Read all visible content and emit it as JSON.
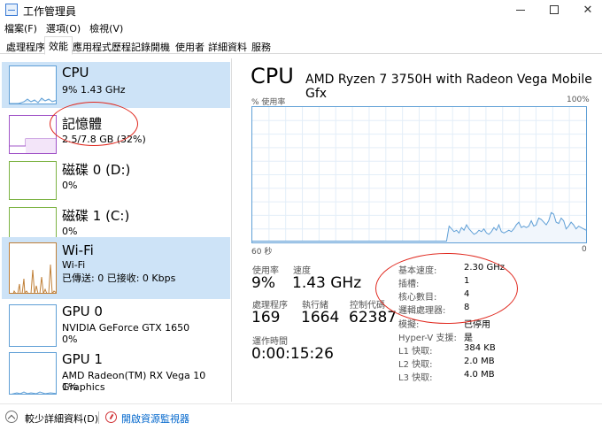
{
  "window": {
    "title": "工作管理員"
  },
  "menu": [
    "檔案(F)",
    "選項(O)",
    "檢視(V)"
  ],
  "tabs": [
    "處理程序",
    "效能",
    "應用程式歷程記錄",
    "開機",
    "使用者",
    "詳細資料",
    "服務"
  ],
  "active_tab": "效能",
  "sidebar": {
    "items": [
      {
        "title": "CPU",
        "sub1": "9% 1.43 GHz",
        "sub2": ""
      },
      {
        "title": "記憶體",
        "sub1": "2.5/7.8 GB (32%)",
        "sub2": ""
      },
      {
        "title": "磁碟 0 (D:)",
        "sub1": "0%",
        "sub2": ""
      },
      {
        "title": "磁碟 1 (C:)",
        "sub1": "0%",
        "sub2": ""
      },
      {
        "title": "Wi-Fi",
        "sub1": "Wi-Fi",
        "sub2": "已傳送: 0 已接收: 0 Kbps"
      },
      {
        "title": "GPU 0",
        "sub1": "NVIDIA GeForce GTX 1650",
        "sub2": "0%"
      },
      {
        "title": "GPU 1",
        "sub1": "AMD Radeon(TM) RX Vega 10 Graphics",
        "sub2": "1%"
      }
    ]
  },
  "main": {
    "title": "CPU",
    "cpu_name": "AMD Ryzen 7 3750H with Radeon Vega Mobile Gfx",
    "graph_top_left": "% 使用率",
    "graph_top_right": "100%",
    "graph_bottom_left": "60 秒",
    "graph_bottom_right": "0",
    "stats": {
      "usage_label": "使用率",
      "usage_value": "9%",
      "speed_label": "速度",
      "speed_value": "1.43 GHz",
      "processes_label": "處理程序",
      "processes_value": "169",
      "threads_label": "執行緒",
      "threads_value": "1664",
      "handles_label": "控制代碼",
      "handles_value": "62387",
      "uptime_label": "運作時間",
      "uptime_value": "0:00:15:26"
    },
    "specs": [
      {
        "label": "基本速度:",
        "value": "2.30 GHz"
      },
      {
        "label": "插槽:",
        "value": "1"
      },
      {
        "label": "核心數目:",
        "value": "4"
      },
      {
        "label": "邏輯處理器:",
        "value": "8"
      },
      {
        "label": "模擬:",
        "value": "已停用"
      },
      {
        "label": "Hyper-V 支援:",
        "value": "是"
      },
      {
        "label": "L1 快取:",
        "value": "384 KB"
      },
      {
        "label": "L2 快取:",
        "value": "2.0 MB"
      },
      {
        "label": "L3 快取:",
        "value": "4.0 MB"
      }
    ]
  },
  "cpu_usage_history": [
    1,
    1,
    1,
    1,
    1,
    1,
    1,
    1,
    1,
    1,
    1,
    1,
    1,
    1,
    1,
    1,
    1,
    1,
    1,
    1,
    1,
    1,
    1,
    1,
    1,
    1,
    1,
    1,
    1,
    1,
    1,
    1,
    1,
    1,
    1,
    1,
    1,
    1,
    1,
    1,
    1,
    1,
    1,
    1,
    1,
    1,
    1,
    1,
    1,
    1,
    1,
    1,
    1,
    1,
    1,
    1,
    1,
    1,
    1,
    1,
    1,
    1,
    1,
    1,
    1,
    1,
    1,
    1,
    1,
    1,
    1,
    1,
    1,
    1,
    1,
    1,
    1,
    1,
    1,
    12,
    10,
    8,
    9,
    7,
    11,
    9,
    13,
    10,
    8,
    6,
    7,
    9,
    8,
    10,
    7,
    6,
    8,
    11,
    9,
    13,
    8,
    7,
    8,
    9,
    8,
    10,
    13,
    15,
    11,
    12,
    11,
    12,
    16,
    12,
    13,
    18,
    17,
    15,
    13,
    16,
    22,
    21,
    15,
    14,
    18,
    16,
    10,
    12,
    15,
    13,
    10,
    12,
    11,
    10,
    9
  ],
  "colors": {
    "accent": "#5f9fd6",
    "selected_bg": "#cde3f7",
    "highlight_circle": "#e0281e",
    "link": "#0066cc"
  },
  "footer": {
    "fewer_details": "較少詳細資料(D)",
    "open_resource_monitor": "開啟資源監視器"
  }
}
